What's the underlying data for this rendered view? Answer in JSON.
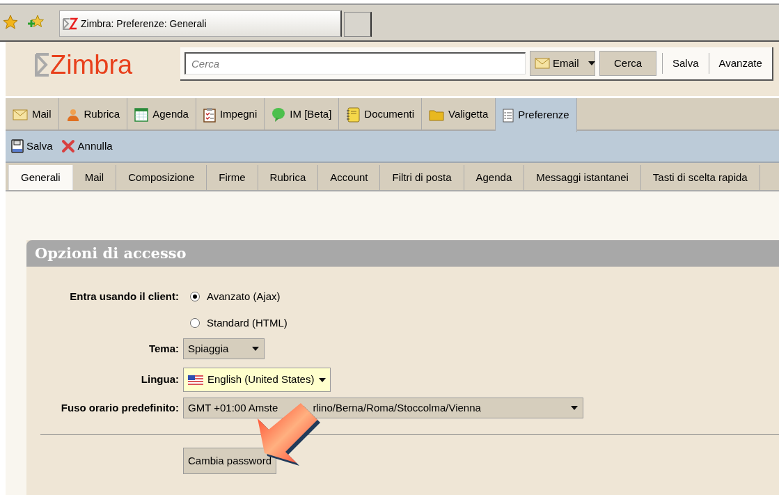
{
  "browser_tab": {
    "title": "Zimbra: Preferenze: Generali"
  },
  "header": {
    "logo": "Zimbra",
    "search": {
      "placeholder": "Cerca"
    },
    "search_type": "Email",
    "search_button": "Cerca",
    "links": [
      "Salva",
      "Avanzate"
    ]
  },
  "app_tabs": [
    {
      "label": "Mail",
      "kind": "mail",
      "selected": false
    },
    {
      "label": "Rubrica",
      "kind": "contacts",
      "selected": false
    },
    {
      "label": "Agenda",
      "kind": "calendar",
      "selected": false
    },
    {
      "label": "Impegni",
      "kind": "tasks",
      "selected": false
    },
    {
      "label": "IM [Beta]",
      "kind": "chat",
      "selected": false
    },
    {
      "label": "Documenti",
      "kind": "documents",
      "selected": false
    },
    {
      "label": "Valigetta",
      "kind": "briefcase",
      "selected": false
    },
    {
      "label": "Preferenze",
      "kind": "preferences",
      "selected": true
    }
  ],
  "toolbar": [
    {
      "label": "Salva",
      "kind": "save"
    },
    {
      "label": "Annulla",
      "kind": "cancel"
    }
  ],
  "pref_tabs": [
    {
      "label": "Generali",
      "selected": true
    },
    {
      "label": "Mail",
      "selected": false
    },
    {
      "label": "Composizione",
      "selected": false
    },
    {
      "label": "Firme",
      "selected": false
    },
    {
      "label": "Rubrica",
      "selected": false
    },
    {
      "label": "Account",
      "selected": false
    },
    {
      "label": "Filtri di posta",
      "selected": false
    },
    {
      "label": "Agenda",
      "selected": false
    },
    {
      "label": "Messaggi istantanei",
      "selected": false
    },
    {
      "label": "Tasti di scelta rapida",
      "selected": false
    }
  ],
  "section": {
    "title": "Opzioni di accesso",
    "client": {
      "label": "Entra usando il client:",
      "options": [
        {
          "label": "Avanzato (Ajax)",
          "selected": true
        },
        {
          "label": "Standard (HTML)",
          "selected": false
        }
      ]
    },
    "theme": {
      "label": "Tema:",
      "value": "Spiaggia"
    },
    "language": {
      "label": "Lingua:",
      "value": "English (United States)"
    },
    "timezone": {
      "label": "Fuso orario predefinito:",
      "value_parts": [
        "GMT +01:00 Amste",
        "rlino/Berna/Roma/Stoccolma/Vienna"
      ]
    },
    "change_password_button": "Cambia password"
  }
}
